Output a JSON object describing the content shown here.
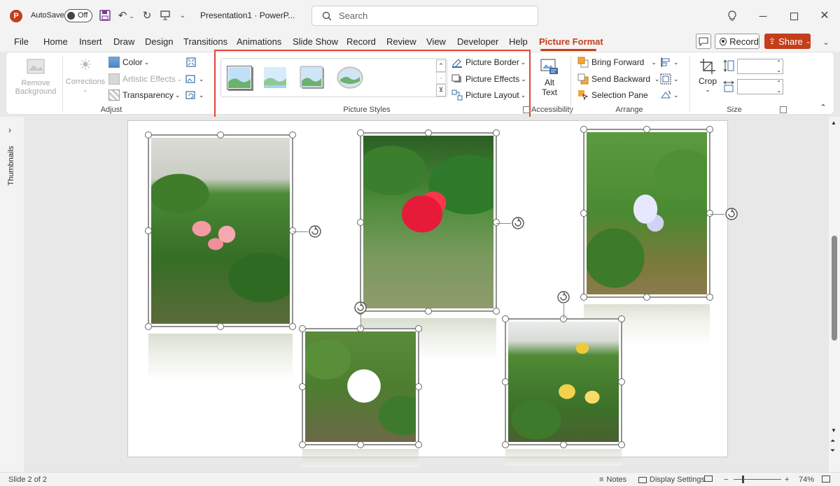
{
  "titlebar": {
    "autosave_label": "AutoSave",
    "autosave_state": "Off",
    "doc_title": "Presentation1 · PowerP...",
    "search_placeholder": "Search"
  },
  "tabs": [
    "File",
    "Home",
    "Insert",
    "Draw",
    "Design",
    "Transitions",
    "Animations",
    "Slide Show",
    "Record",
    "Review",
    "View",
    "Developer",
    "Help",
    "Picture Format"
  ],
  "active_tab": "Picture Format",
  "actions": {
    "record": "Record",
    "share": "Share"
  },
  "ribbon": {
    "remove_background": [
      "Remove",
      "Background"
    ],
    "corrections": "Corrections",
    "color": "Color",
    "artistic_effects": "Artistic Effects",
    "transparency": "Transparency",
    "adjust_label": "Adjust",
    "picture_styles_label": "Picture Styles",
    "picture_border": "Picture Border",
    "picture_effects": "Picture Effects",
    "picture_layout": "Picture Layout",
    "alt_text": [
      "Alt",
      "Text"
    ],
    "accessibility_label": "Accessibility",
    "bring_forward": "Bring Forward",
    "send_backward": "Send Backward",
    "selection_pane": "Selection Pane",
    "arrange_label": "Arrange",
    "crop": "Crop",
    "size_label": "Size"
  },
  "leftrail": {
    "thumbnails": "Thumbnails"
  },
  "status": {
    "slide_counter": "Slide 2 of 2",
    "notes": "Notes",
    "display_settings": "Display Settings",
    "zoom": "74%"
  },
  "colors": {
    "accent": "#c43e1c",
    "highlight_box": "#e0463a",
    "share_bg": "#c43e1c"
  }
}
